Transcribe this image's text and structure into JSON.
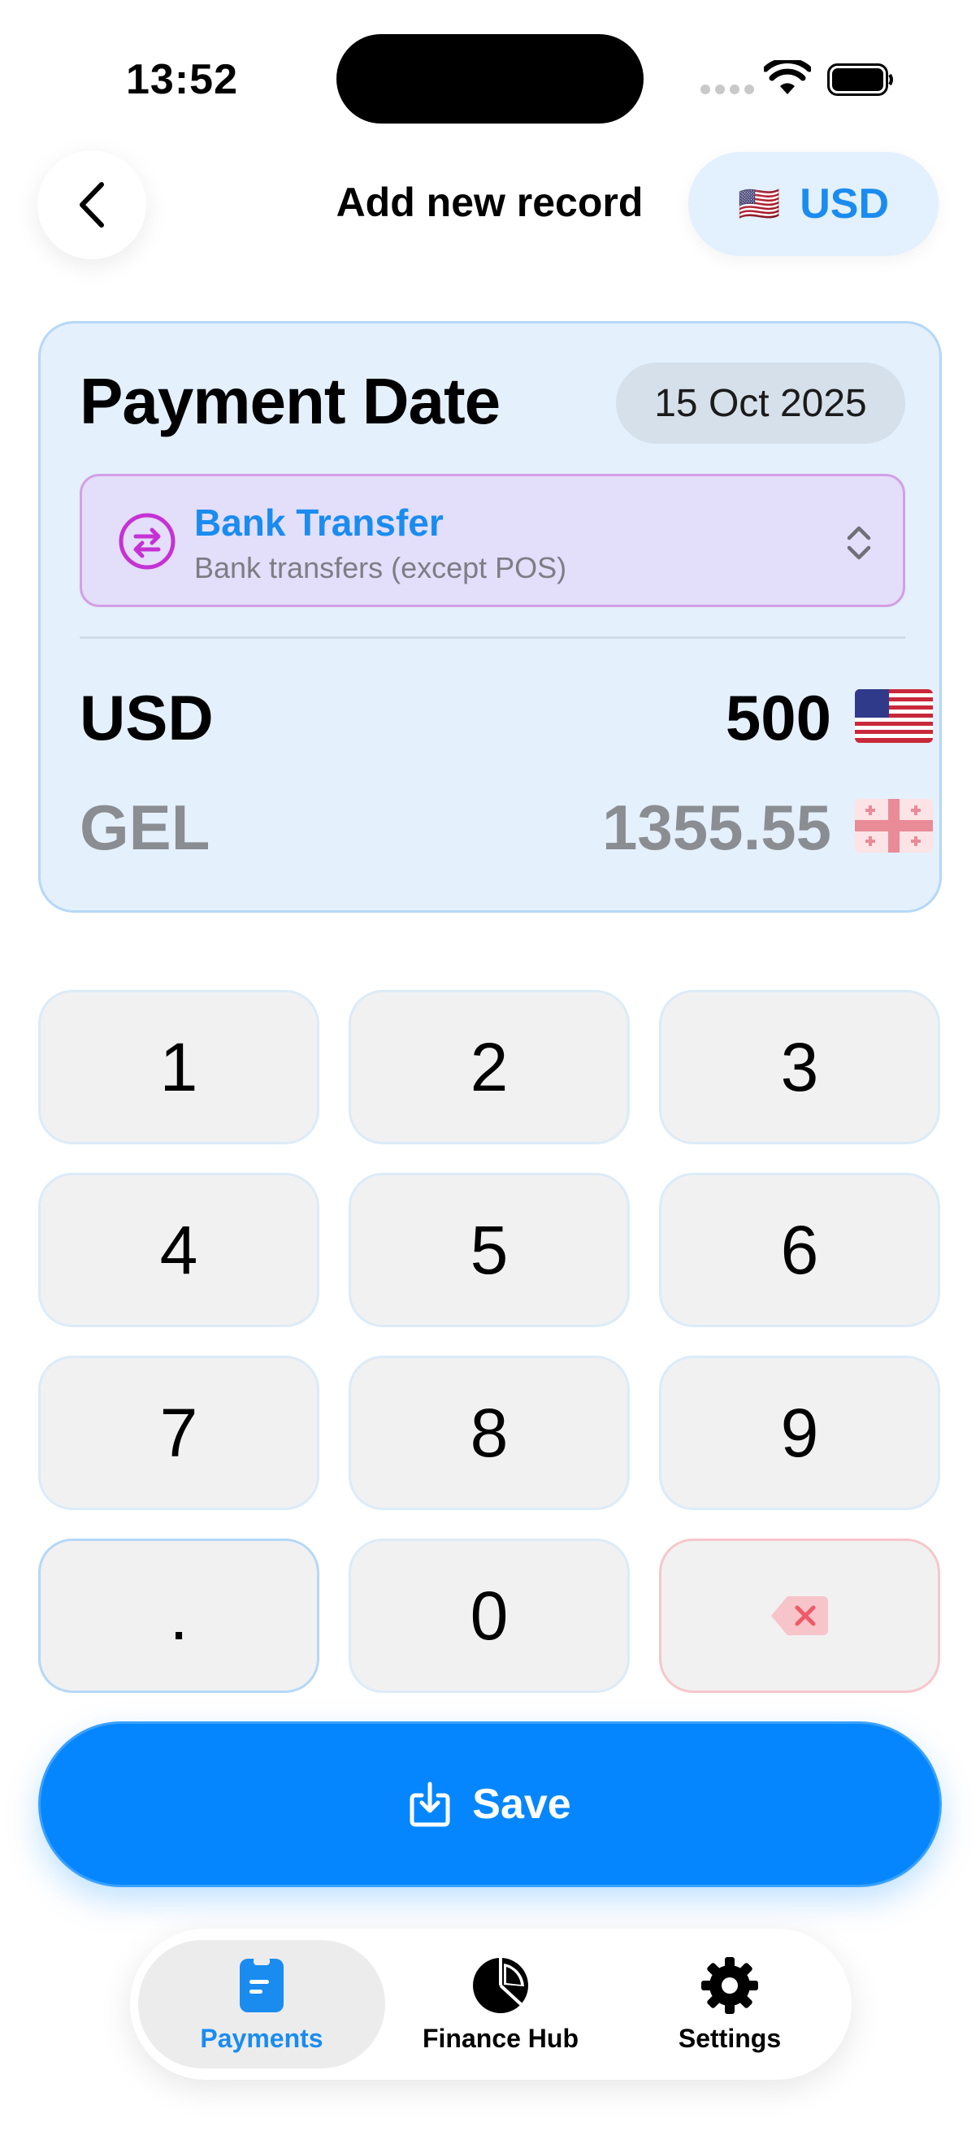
{
  "status_bar": {
    "time": "13:52"
  },
  "header": {
    "back_icon": "chevron-left-icon",
    "title": "Add new record",
    "currency": {
      "flag": "🇺🇸",
      "code": "USD"
    }
  },
  "card": {
    "title": "Payment Date",
    "date": "15 Oct 2025",
    "payment_method": {
      "icon": "transfer-arrows-icon",
      "name": "Bank Transfer",
      "description": "Bank transfers (except POS)",
      "selector_icon": "chevron-up-down-icon"
    },
    "amounts": [
      {
        "code": "USD",
        "value": "500",
        "flag": "us-flag"
      },
      {
        "code": "GEL",
        "value": "1355.55",
        "flag": "georgia-flag"
      }
    ]
  },
  "keypad": {
    "keys": [
      "1",
      "2",
      "3",
      "4",
      "5",
      "6",
      "7",
      "8",
      "9",
      ".",
      "0"
    ],
    "delete_icon": "backspace-icon"
  },
  "save_button": {
    "label": "Save",
    "icon": "download-tray-icon"
  },
  "tab_bar": {
    "tabs": [
      {
        "label": "Payments",
        "icon": "clipboard-icon",
        "active": true
      },
      {
        "label": "Finance Hub",
        "icon": "pie-chart-icon",
        "active": false
      },
      {
        "label": "Settings",
        "icon": "gear-icon",
        "active": false
      }
    ]
  },
  "colors": {
    "accent": "#0586ff",
    "link_blue": "#1a8cf0",
    "card_bg": "#e4f0fc",
    "method_bg": "#e3def9",
    "method_icon": "#c532d4",
    "delete_red": "#ef5a69"
  }
}
